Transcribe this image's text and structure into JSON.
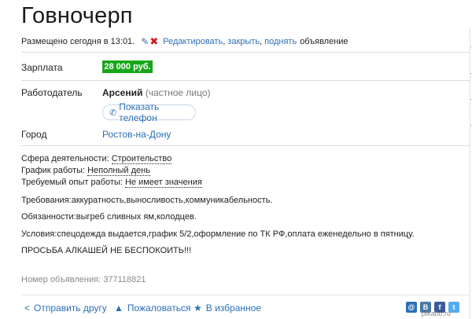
{
  "ad": {
    "title": "Говночерп",
    "posted": "Размещено сегодня в 13:01.",
    "actions": {
      "edit": "Редактировать",
      "close": "закрыть",
      "raise": "поднять",
      "suffix": "объявление"
    },
    "salary_label": "Зарплата",
    "salary_value": "28 000 руб.",
    "employer_label": "Работодатель",
    "employer_name": "Арсений",
    "employer_type": "(частное лицо)",
    "phone_button": "Показать телефон",
    "city_label": "Город",
    "city_value": "Ростов-на-Дону",
    "features": [
      {
        "label": "Сфера деятельности: ",
        "value": "Строительство"
      },
      {
        "label": "График работы: ",
        "value": "Неполный день"
      },
      {
        "label": "Требуемый опыт работы: ",
        "value": "Не имеет значения"
      }
    ],
    "description": [
      "Требования:аккуратность,выносливость,коммуникабельность.",
      "Обязанности:выгреб сливных ям,колодцев.",
      "Условия:спецодежда выдается,график 5/2,оформление по ТК РФ,оплата еженедельно в пятницу.",
      "ПРОСЬБА АЛКАШЕЙ НЕ БЕСПОКОИТЬ!!!"
    ],
    "ad_number": "Номер объявления: 377118821"
  },
  "footer": {
    "send_friend": "Отправить другу",
    "complain": "Пожаловаться",
    "favorite": "В избранное",
    "social": [
      {
        "icon": "odnoklassniki-icon",
        "glyph": "@",
        "color": "#2d6fb5"
      },
      {
        "icon": "vkontakte-icon",
        "glyph": "В",
        "color": "#4a76a8"
      },
      {
        "icon": "facebook-icon",
        "glyph": "f",
        "color": "#3b5998"
      },
      {
        "icon": "twitter-icon",
        "glyph": "t",
        "color": "#55acee"
      }
    ]
  },
  "watermark": "pikabu.ru"
}
